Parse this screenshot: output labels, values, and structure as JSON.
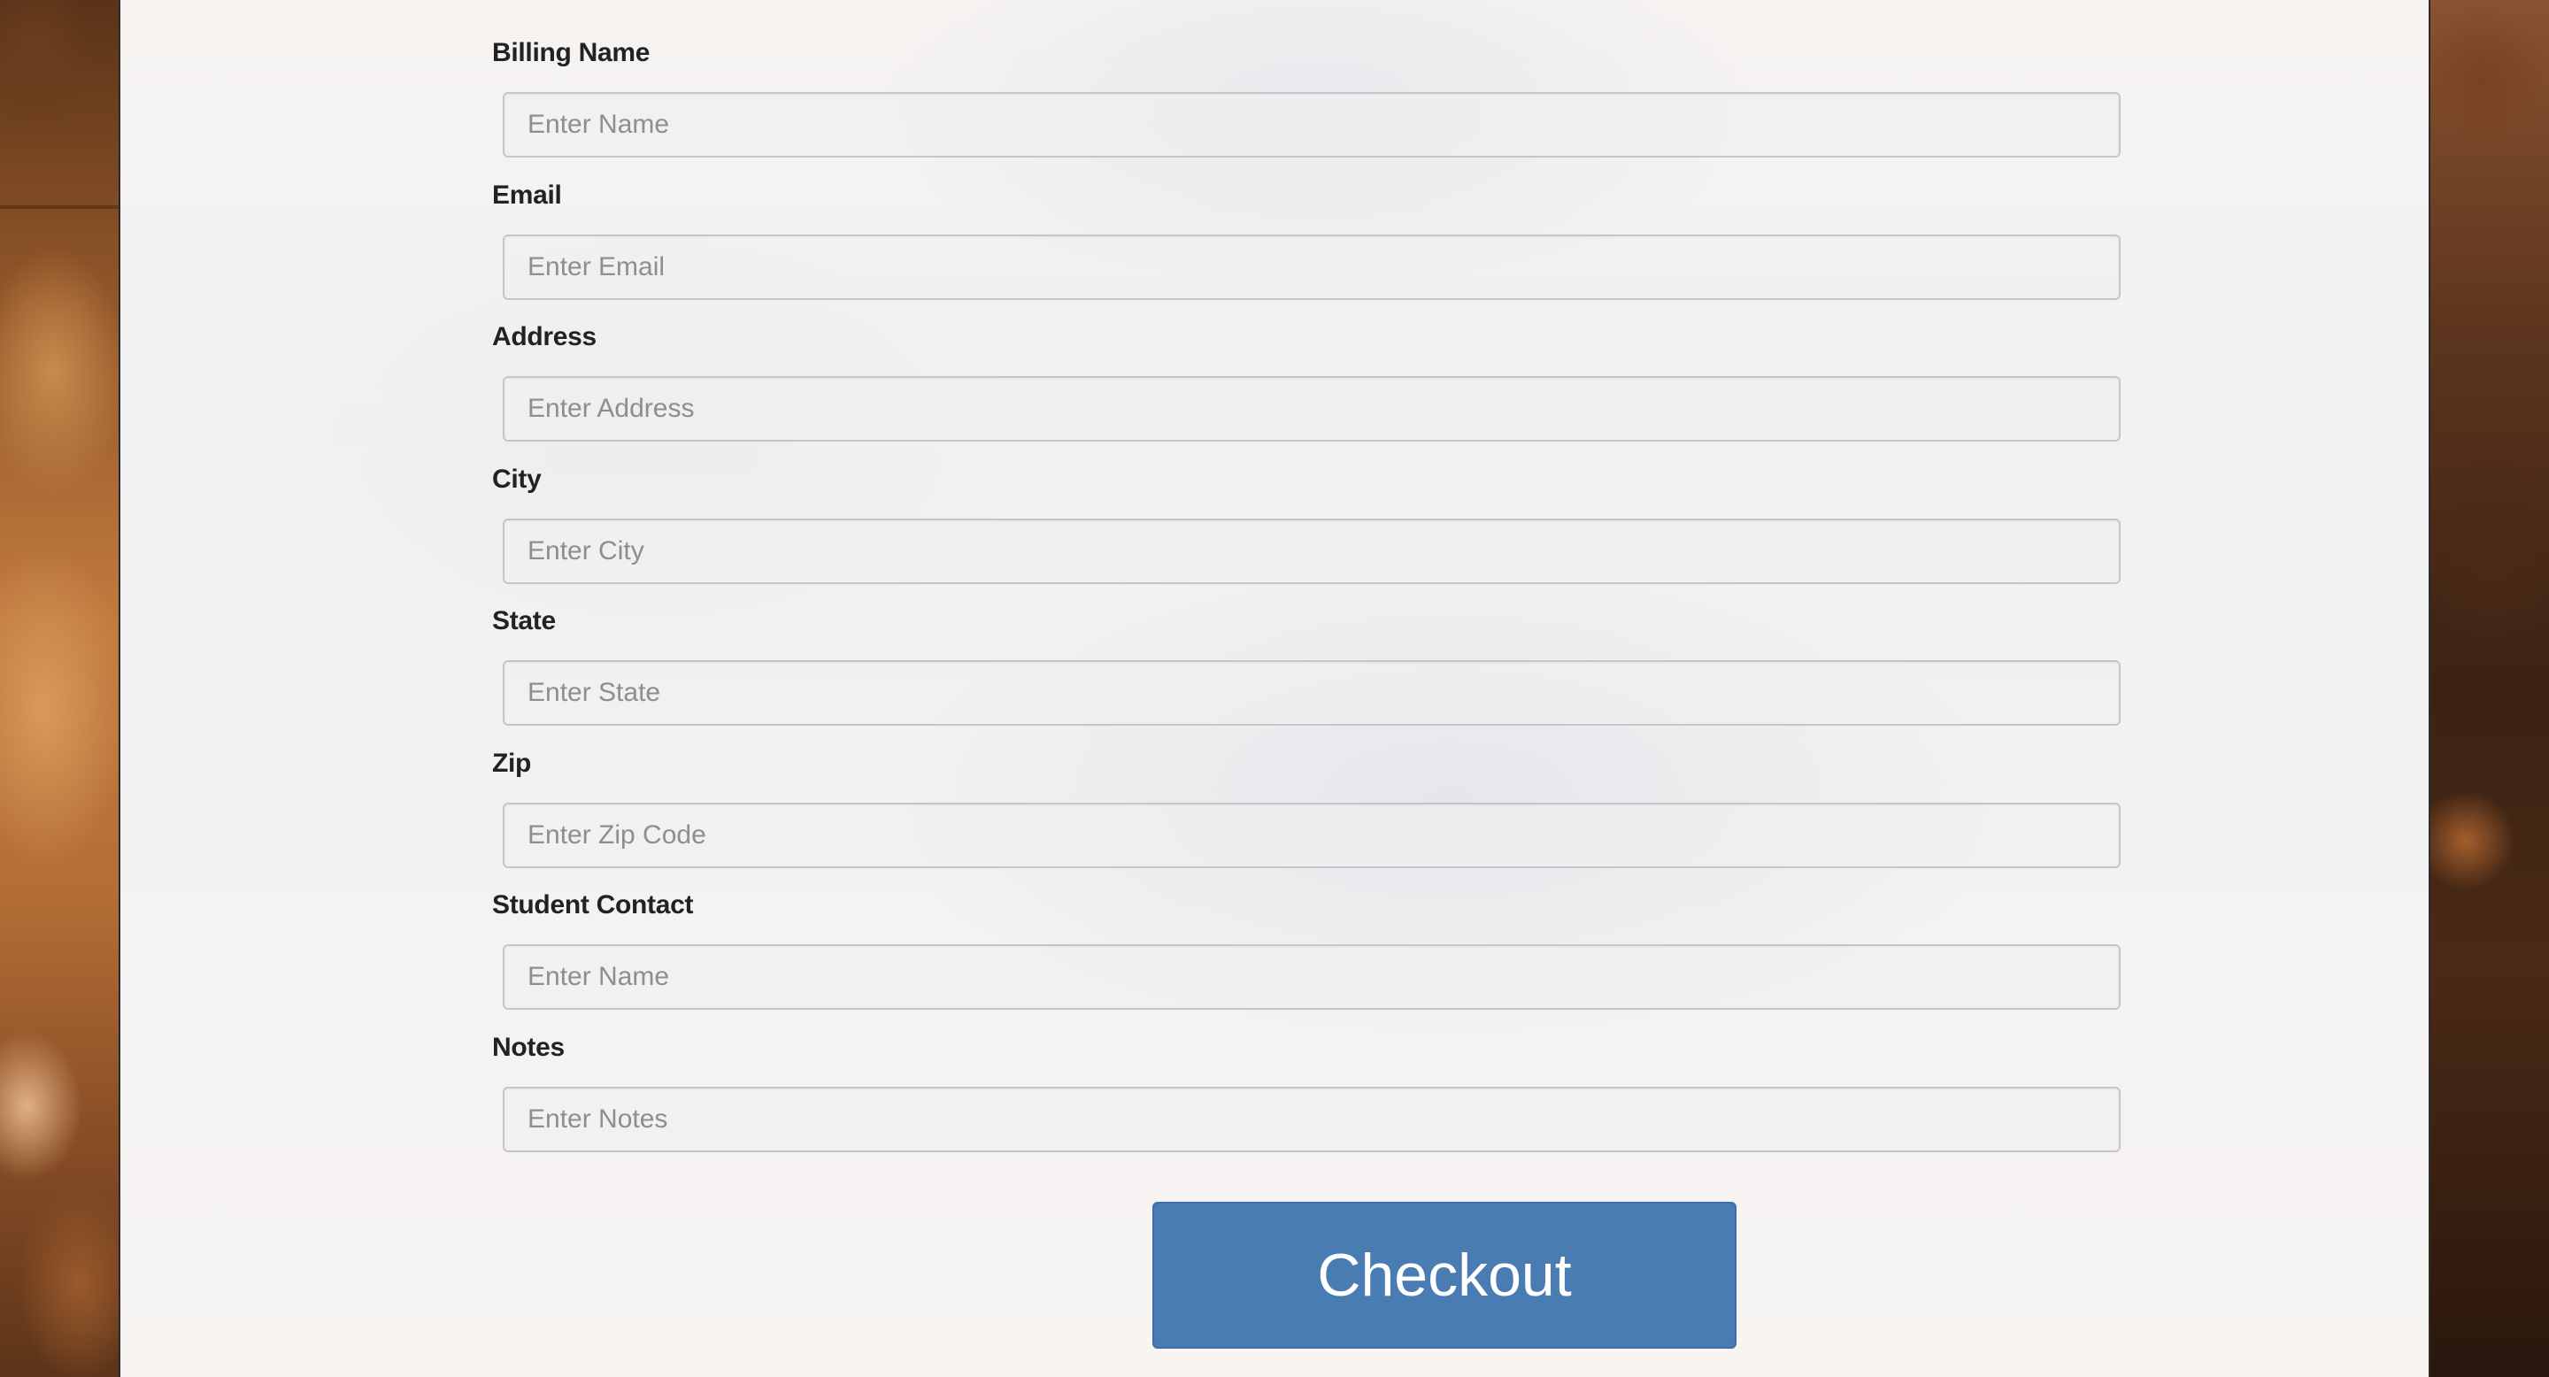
{
  "form": {
    "fields": [
      {
        "label": "Billing Name",
        "placeholder": "Enter Name",
        "value": ""
      },
      {
        "label": "Email",
        "placeholder": "Enter Email",
        "value": ""
      },
      {
        "label": "Address",
        "placeholder": "Enter Address",
        "value": ""
      },
      {
        "label": "City",
        "placeholder": "Enter City",
        "value": ""
      },
      {
        "label": "State",
        "placeholder": "Enter State",
        "value": ""
      },
      {
        "label": "Zip",
        "placeholder": "Enter Zip Code",
        "value": ""
      },
      {
        "label": "Student Contact",
        "placeholder": "Enter Name",
        "value": ""
      },
      {
        "label": "Notes",
        "placeholder": "Enter Notes",
        "value": ""
      }
    ],
    "submit_label": "Checkout"
  },
  "colors": {
    "button": "#4a7cb4",
    "label": "#222222",
    "placeholder": "#8e8e8e"
  }
}
